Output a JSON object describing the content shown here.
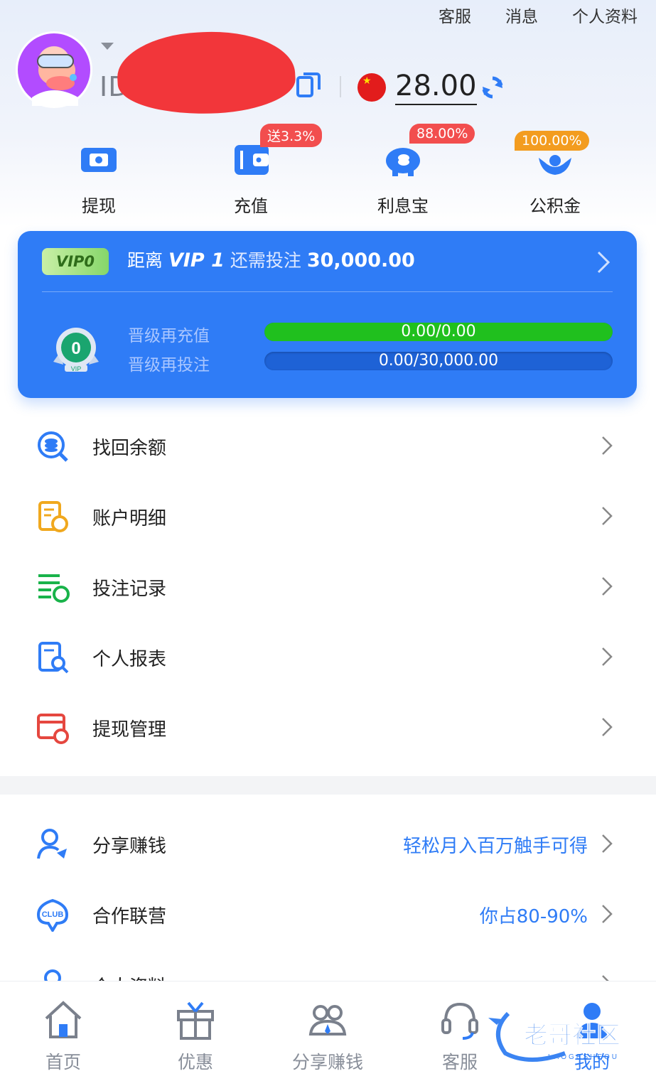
{
  "top_links": [
    "客服",
    "消息",
    "个人资料"
  ],
  "user": {
    "id_label": "ID:",
    "balance": "28.00"
  },
  "quick_actions": [
    {
      "label": "提现",
      "badge": ""
    },
    {
      "label": "充值",
      "badge": "送3.3%"
    },
    {
      "label": "利息宝",
      "badge": "88.00%"
    },
    {
      "label": "公积金",
      "badge": "100.00%"
    }
  ],
  "vip": {
    "tag": "VIP0",
    "prefix": "距离",
    "target": "VIP 1",
    "middle": "还需投注",
    "amount": "30,000.00",
    "level_number": "0",
    "medal_text": "VIP",
    "recharge_label": "晋级再充值",
    "recharge_value": "0.00/0.00",
    "recharge_progress": 1.0,
    "bet_label": "晋级再投注",
    "bet_value": "0.00/30,000.00",
    "bet_progress": 0.0
  },
  "menu": [
    {
      "label": "找回余额",
      "icon": "search-coin-icon"
    },
    {
      "label": "账户明细",
      "icon": "account-detail-icon"
    },
    {
      "label": "投注记录",
      "icon": "bet-record-icon"
    },
    {
      "label": "个人报表",
      "icon": "report-icon"
    },
    {
      "label": "提现管理",
      "icon": "withdraw-manage-icon"
    }
  ],
  "menu2": [
    {
      "label": "分享赚钱",
      "hint": "轻松月入百万触手可得",
      "icon": "share-earn-icon"
    },
    {
      "label": "合作联营",
      "hint": "你占80-90%",
      "icon": "club-icon"
    },
    {
      "label": "个人资料",
      "hint": "",
      "icon": "profile-icon"
    }
  ],
  "tabs": [
    {
      "label": "首页",
      "icon": "home-icon"
    },
    {
      "label": "优惠",
      "icon": "gift-icon"
    },
    {
      "label": "分享赚钱",
      "icon": "share-users-icon"
    },
    {
      "label": "客服",
      "icon": "headset-icon"
    },
    {
      "label": "我的",
      "icon": "user-icon"
    }
  ],
  "watermark": {
    "text": "老哥社区",
    "sub": "LAOGESHEQU"
  },
  "colors": {
    "primary": "#2f7cf6",
    "progress_green": "#20c01e",
    "badge_red": "#f24e4e",
    "badge_orange": "#f39c1f"
  }
}
